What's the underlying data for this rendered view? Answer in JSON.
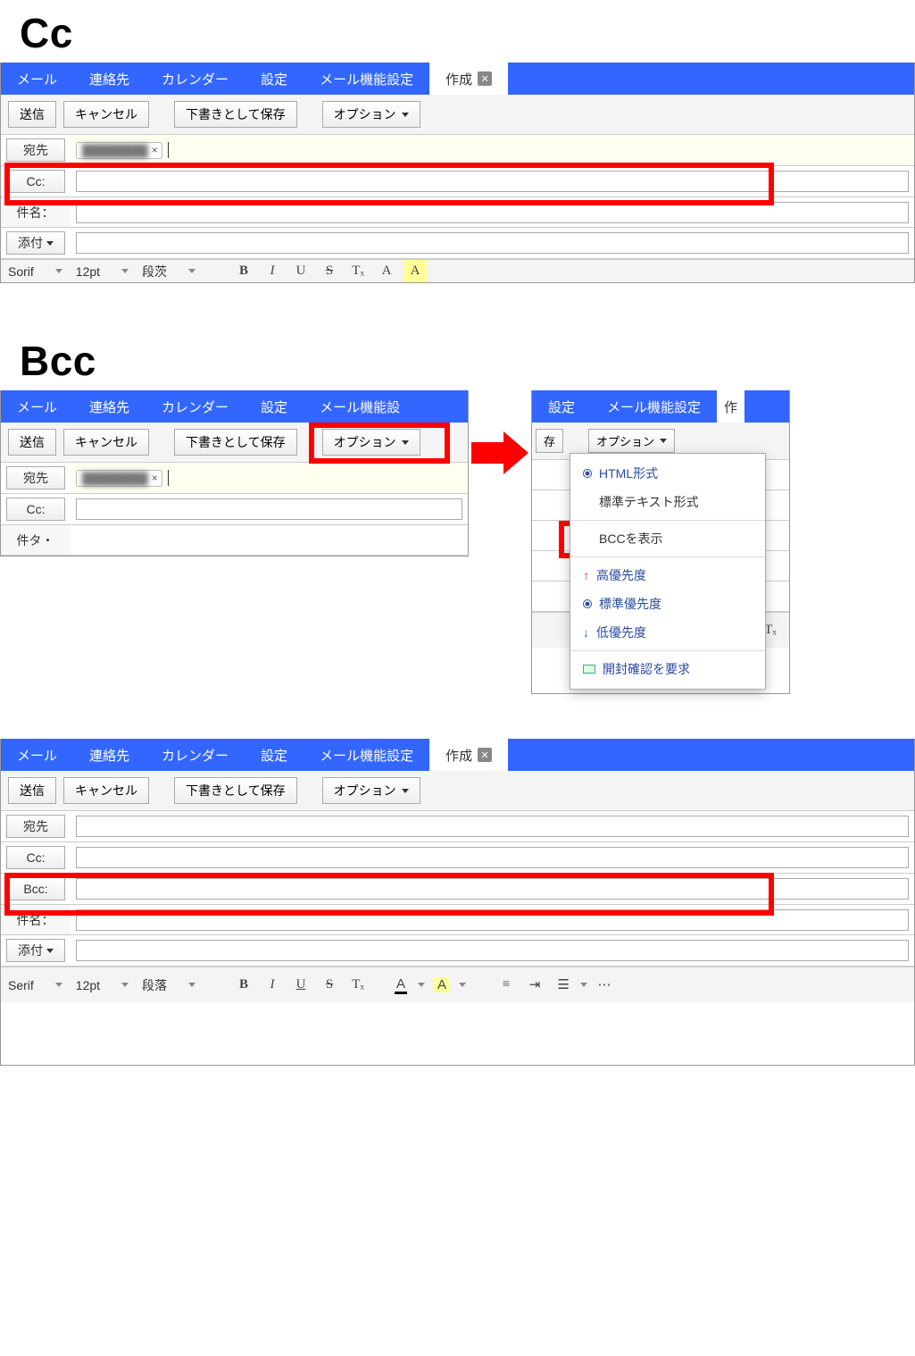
{
  "headings": {
    "cc": "Cc",
    "bcc": "Bcc"
  },
  "tabs": {
    "mail": "メール",
    "contacts": "連絡先",
    "calendar": "カレンダー",
    "settings": "設定",
    "mailFunc": "メール機能設定",
    "mailFuncCut": "メール機能設",
    "compose": "作成",
    "composeCut": "作"
  },
  "toolbar": {
    "send": "送信",
    "cancel": "キャンセル",
    "saveDraft": "下書きとして保存",
    "saveDraftCut": "存",
    "options": "オプション"
  },
  "labels": {
    "to": "宛先",
    "cc": "Cc:",
    "bcc": "Bcc:",
    "subject": "件名：",
    "subjectCut": "件タ・",
    "attach": "添付"
  },
  "chip": {
    "remove": "×"
  },
  "editor": {
    "font": "Serif",
    "fontCut": "Sorif",
    "size": "12pt",
    "para": "段落",
    "paraCut": "段茨",
    "b": "B",
    "i": "I",
    "u": "U",
    "s": "S",
    "tx": "Tₓ",
    "a": "A"
  },
  "menu": {
    "html": "HTML形式",
    "plain": "標準テキスト形式",
    "showBcc": "BCCを表示",
    "high": "高優先度",
    "normal": "標準優先度",
    "low": "低優先度",
    "receipt": "開封確認を要求"
  }
}
